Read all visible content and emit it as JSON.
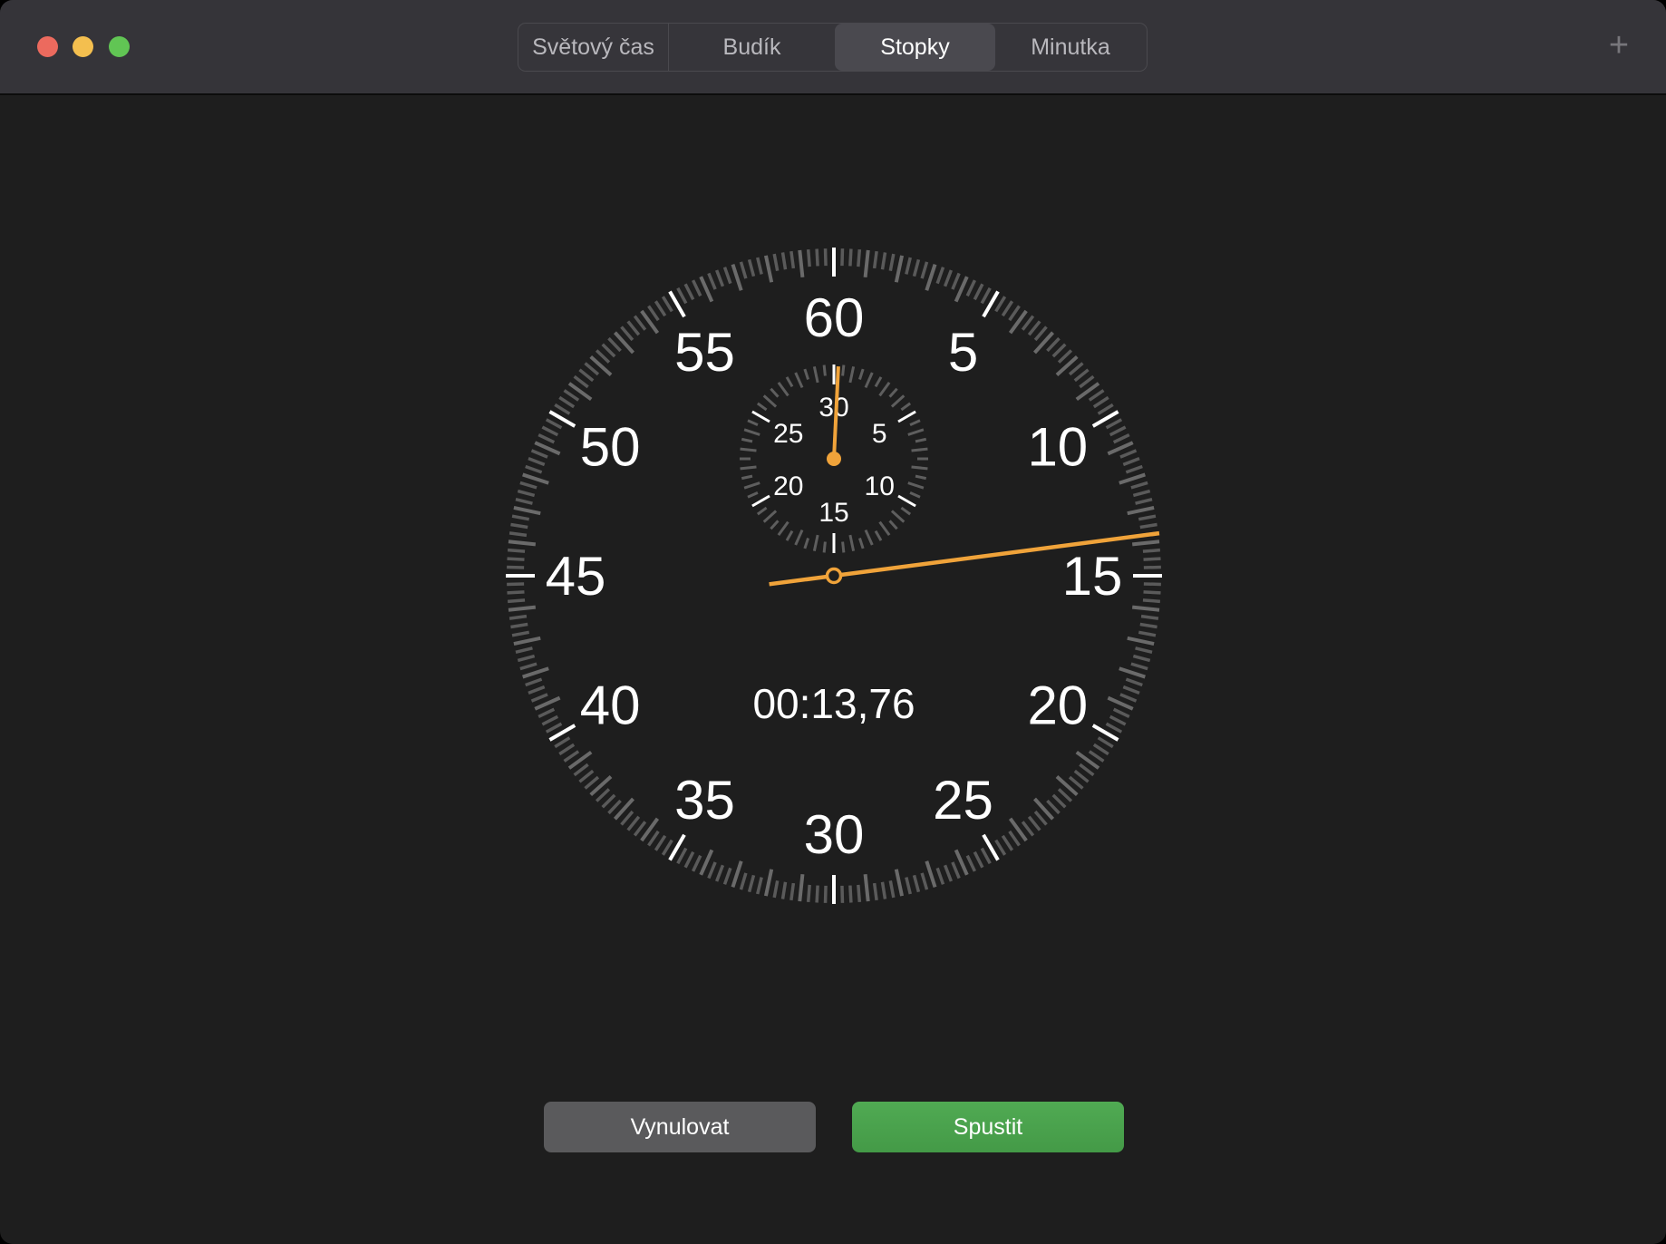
{
  "window": {
    "controls": [
      "close",
      "minimize",
      "zoom"
    ],
    "colors": {
      "close": "#ec6a5e",
      "minimize": "#f4bf4f",
      "zoom": "#61c554"
    }
  },
  "tabs": [
    {
      "label": "Světový čas",
      "selected": false
    },
    {
      "label": "Budík",
      "selected": false
    },
    {
      "label": "Stopky",
      "selected": true
    },
    {
      "label": "Minutka",
      "selected": false
    }
  ],
  "toolbar": {
    "add_icon": "plus-icon"
  },
  "stopwatch": {
    "elapsed_display": "00:13,76",
    "elapsed_seconds": 13.76,
    "main_labels": [
      "60",
      "5",
      "10",
      "15",
      "20",
      "25",
      "30",
      "35",
      "40",
      "45",
      "50",
      "55"
    ],
    "sub_labels": [
      "30",
      "5",
      "10",
      "15",
      "20",
      "25"
    ],
    "sub_dial_max_minutes": 30,
    "hand_color": "#f0a33a"
  },
  "buttons": {
    "reset": "Vynulovat",
    "start": "Spustit"
  },
  "colors": {
    "start": "#4aa14d",
    "reset": "#5a5a5c"
  }
}
